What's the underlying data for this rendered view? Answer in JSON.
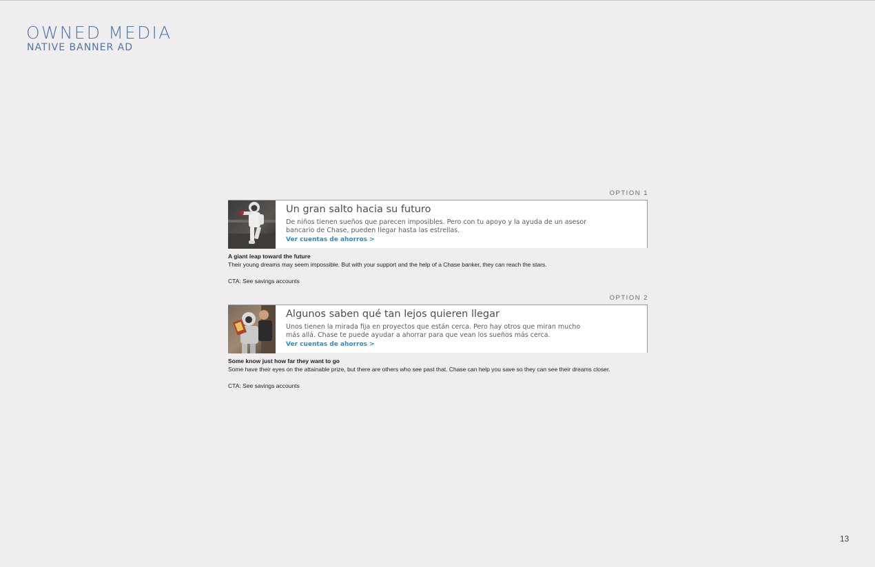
{
  "header": {
    "title": "OWNED MEDIA",
    "subtitle": "NATIVE BANNER AD"
  },
  "page_number": "13",
  "options": [
    {
      "label": "OPTION 1",
      "ad": {
        "headline": "Un gran salto hacia su futuro",
        "body": "De niños tienen sueños que parecen imposibles. Pero con tu apoyo y la ayuda de un asesor bancario de Chase, pueden llegar hasta las estrellas.",
        "cta": "Ver cuentas de ahorros >"
      },
      "translation": {
        "headline": "A giant leap toward the future",
        "body": "Their young dreams may seem impossible. But with your support and the help of a Chase banker, they can reach the stars.",
        "cta": "CTA: See savings accounts"
      }
    },
    {
      "label": "OPTION 2",
      "ad": {
        "headline": "Algunos saben qué tan lejos quieren llegar",
        "body": "Unos tienen la mirada fija en proyectos que están cerca. Pero hay otros que miran mucho más allá. Chase te puede ayudar a ahorrar para que vean los sueños más cerca.",
        "cta": "Ver cuentas de ahorros >"
      },
      "translation": {
        "headline": "Some know just how far they want to go",
        "body": "Some have their eyes on the attainable prize, but there are others who see past that. Chase can help you save so they can see their dreams closer.",
        "cta": "CTA: See savings accounts"
      }
    }
  ],
  "colors": {
    "background": "#efedee",
    "title": "#4a76aa",
    "cta": "#1e8fd1"
  }
}
